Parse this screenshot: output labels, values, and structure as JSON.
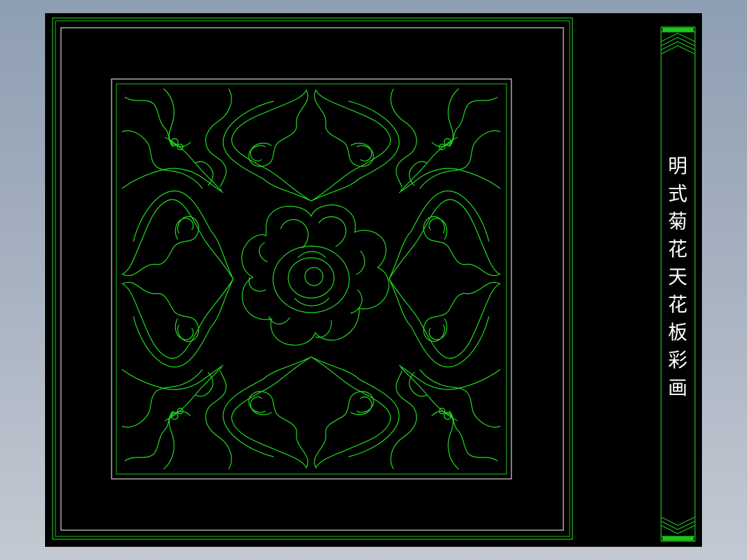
{
  "title_block": {
    "title_chars": [
      "明",
      "式",
      "菊",
      "花",
      "天",
      "花",
      "板",
      "彩",
      "画"
    ]
  },
  "colors": {
    "background": "#000000",
    "ornament_line": "#22dd22",
    "frame_line": "#ffffff",
    "frame_green": "#1fc21f",
    "viewport_gradient_top": "#8e9eb3",
    "viewport_gradient_bottom": "#c3c9d2"
  },
  "ornament": {
    "symmetry": "four-fold",
    "center": "chrysanthemum-flower",
    "corners": "leaf-sprays",
    "sides": "scroll-lobes"
  }
}
